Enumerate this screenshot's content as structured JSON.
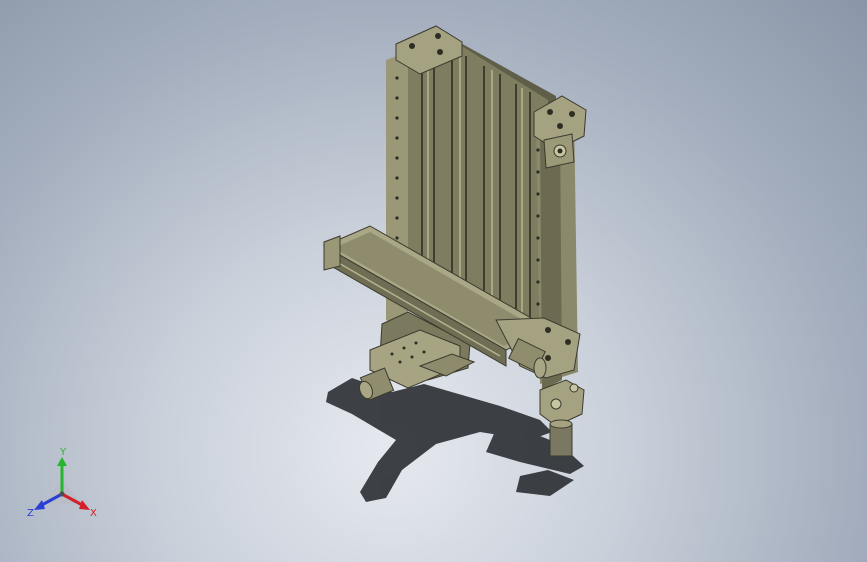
{
  "viewport": {
    "background_center": "#e6e9ef",
    "background_edge": "#8a96a8",
    "model_body_color": "#8d8b6b",
    "model_shadow_color": "#2f3236"
  },
  "triad": {
    "x_label": "X",
    "y_label": "Y",
    "z_label": "Z",
    "x_color": "#d4202a",
    "y_color": "#27b52f",
    "z_color": "#2a3fd6"
  }
}
